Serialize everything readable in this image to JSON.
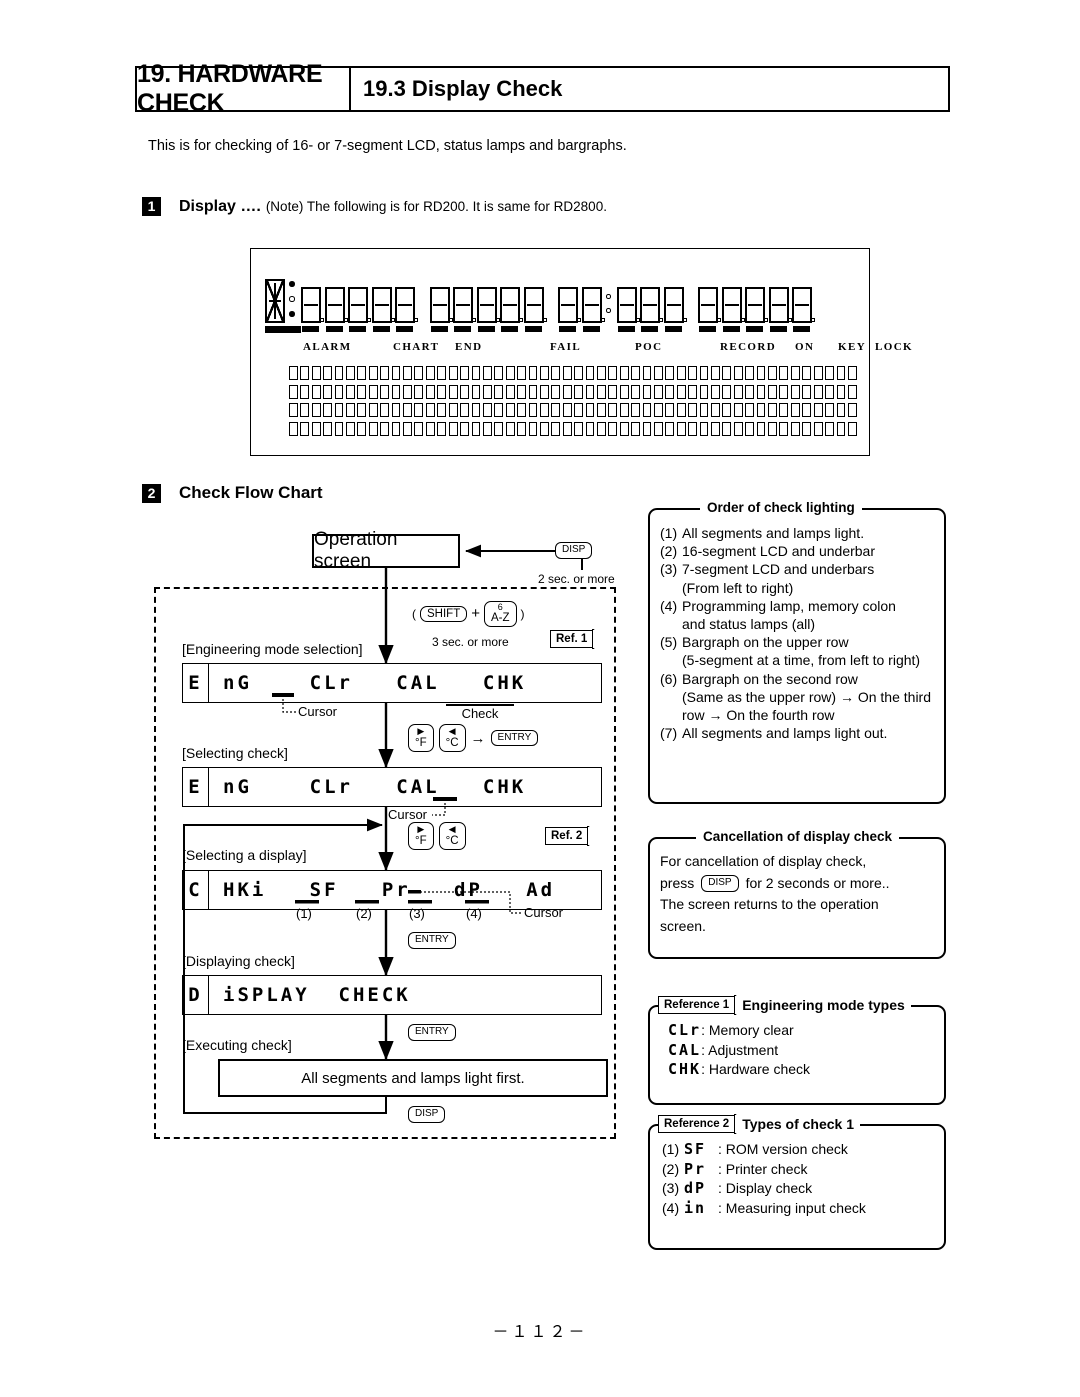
{
  "header": {
    "chapter": "19. HARDWARE CHECK",
    "section": "19.3 Display Check"
  },
  "intro": "This is for checking of 16- or 7-segment LCD, status lamps and bargraphs.",
  "sections": {
    "one": {
      "num": "1",
      "title": "Display ….",
      "note": "(Note) The following is for RD200. It is same for RD2800."
    },
    "two": {
      "num": "2",
      "title": "Check Flow Chart"
    }
  },
  "lcd_panel": {
    "digit_groups": [
      5,
      5,
      5,
      5
    ],
    "colon_group_index": 2,
    "colon_after_digit": 2,
    "status_labels": [
      "ALARM",
      "CHART",
      "END",
      "FAIL",
      "POC",
      "RECORD",
      "ON",
      "KEY",
      "LOCK"
    ],
    "bargraph_rows": 4,
    "bargraph_cells_per_row": 50
  },
  "flow": {
    "operation_screen": "Operation screen",
    "disp_key": "DISP",
    "disp_hold": "2 sec. or more",
    "combo_open": "(",
    "combo_shift": "SHIFT",
    "combo_plus": "+",
    "combo_key_top": "6",
    "combo_key_bottom": "A-Z",
    "combo_close": ")",
    "combo_hold": "3 sec. or more",
    "ref1_tag": "Ref. 1",
    "ref2_tag": "Ref. 2",
    "step1_label": "[Engineering mode selection]",
    "step1_lead": "E",
    "step1_text": "nG    CLr   CAL   CHK",
    "step2_label": "[Selecting check]",
    "step2_lead": "E",
    "step2_text": "nG    CLr   CAL   CHK",
    "step3_label": "[Selecting a display]",
    "step3_lead": "C",
    "step3_text": "HKi   SF   Pr   dP   Ad",
    "step4_label": "[Displaying check]",
    "step4_lead": "D",
    "step4_text": "iSPLAY  CHECK",
    "step5_label": "[Executing check]",
    "step5_text": "All segments and lamps light first.",
    "cursor_label": "Cursor",
    "check_label": "Check",
    "key_right_top": "▶",
    "key_right_bottom": "°F",
    "key_left_top": "◀",
    "key_left_bottom": "°C",
    "arrow_to": "→",
    "entry_key": "ENTRY",
    "markers": [
      "(1)",
      "(2)",
      "(3)",
      "(4)"
    ]
  },
  "order_panel": {
    "title": "Order of check lighting",
    "items": [
      {
        "n": "(1)",
        "t": "All segments and lamps light."
      },
      {
        "n": "(2)",
        "t": "16-segment LCD and underbar"
      },
      {
        "n": "(3)",
        "t": "7-segment LCD and underbars",
        "c": "(From left to right)"
      },
      {
        "n": "(4)",
        "t": "Programming lamp, memory colon",
        "c": "and status lamps (all)"
      },
      {
        "n": "(5)",
        "t": "Bargraph on the upper row",
        "c": "(5-segment at a time, from left to right)"
      },
      {
        "n": "(6)",
        "t": "Bargraph on the second row",
        "c": "(Same as the upper row) → On the third row → On the fourth row"
      },
      {
        "n": "(7)",
        "t": "All segments and lamps light out."
      }
    ]
  },
  "cancel_panel": {
    "title": "Cancellation of display check",
    "line1": "For cancellation of display check,",
    "press": "press",
    "key": "DISP",
    "line2b": "for 2 seconds or more..",
    "line3": "The  screen  returns  to  the  operation",
    "line4": "screen."
  },
  "ref1_panel": {
    "tag": "Reference 1",
    "title": "Engineering mode types",
    "rows": [
      {
        "seg": "CLr",
        "desc": ": Memory clear"
      },
      {
        "seg": "CAL",
        "desc": ": Adjustment"
      },
      {
        "seg": "CHK",
        "desc": ": Hardware check"
      }
    ]
  },
  "ref2_panel": {
    "tag": "Reference 2",
    "title": "Types of check 1",
    "rows": [
      {
        "n": "(1)",
        "seg": "SF",
        "desc": ": ROM version check"
      },
      {
        "n": "(2)",
        "seg": "Pr",
        "desc": ": Printer check"
      },
      {
        "n": "(3)",
        "seg": "dP",
        "desc": ": Display check"
      },
      {
        "n": "(4)",
        "seg": "in",
        "desc": ": Measuring input check"
      }
    ]
  },
  "page_number": "－１１２－"
}
